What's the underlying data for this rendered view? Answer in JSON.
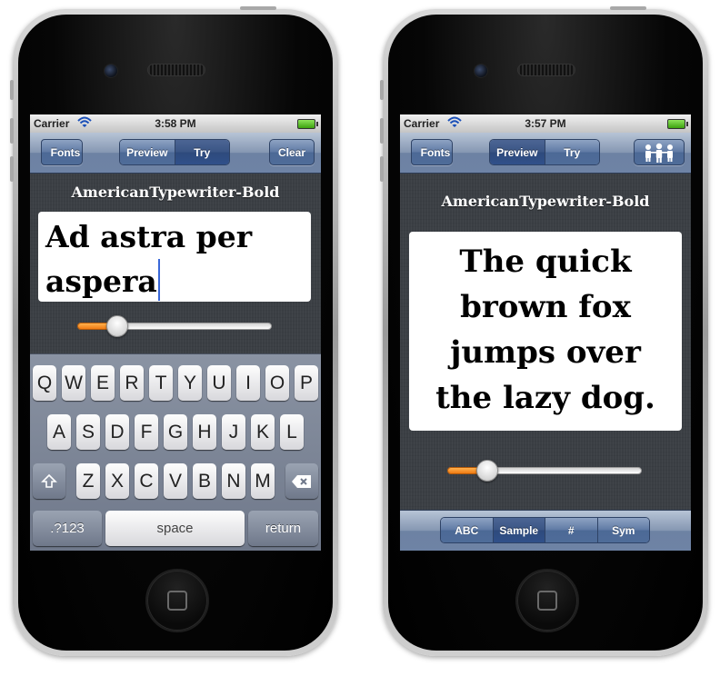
{
  "left_phone": {
    "status": {
      "carrier": "Carrier",
      "time": "3:58 PM"
    },
    "nav": {
      "back_label": "Fonts",
      "segments": [
        "Preview",
        "Try"
      ],
      "selected_segment": "Try",
      "right_button": "Clear"
    },
    "font_name": "AmericanTypewriter-Bold",
    "text_field": {
      "line1": "Ad astra per",
      "line2": "aspera"
    },
    "slider": {
      "value": 0.2
    },
    "keyboard": {
      "row1": [
        "Q",
        "W",
        "E",
        "R",
        "T",
        "Y",
        "U",
        "I",
        "O",
        "P"
      ],
      "row2": [
        "A",
        "S",
        "D",
        "F",
        "G",
        "H",
        "J",
        "K",
        "L"
      ],
      "row3": [
        "Z",
        "X",
        "C",
        "V",
        "B",
        "N",
        "M"
      ],
      "numbers_key": ".?123",
      "space_key": "space",
      "return_key": "return"
    }
  },
  "right_phone": {
    "status": {
      "carrier": "Carrier",
      "time": "3:57 PM"
    },
    "nav": {
      "back_label": "Fonts",
      "segments": [
        "Preview",
        "Try"
      ],
      "selected_segment": "Preview",
      "right_icon": "people-icon"
    },
    "font_name": "AmericanTypewriter-Bold",
    "sample_text": [
      "The quick",
      "brown fox",
      "jumps over",
      "the lazy dog."
    ],
    "slider": {
      "value": 0.2
    },
    "bottom_tabs": [
      "ABC",
      "Sample",
      "#",
      "Sym"
    ],
    "selected_tab": "Sample"
  },
  "colors": {
    "nav_blue": "#6e83a5",
    "slider_orange": "#f07b13",
    "caret_blue": "#3a68d8"
  }
}
